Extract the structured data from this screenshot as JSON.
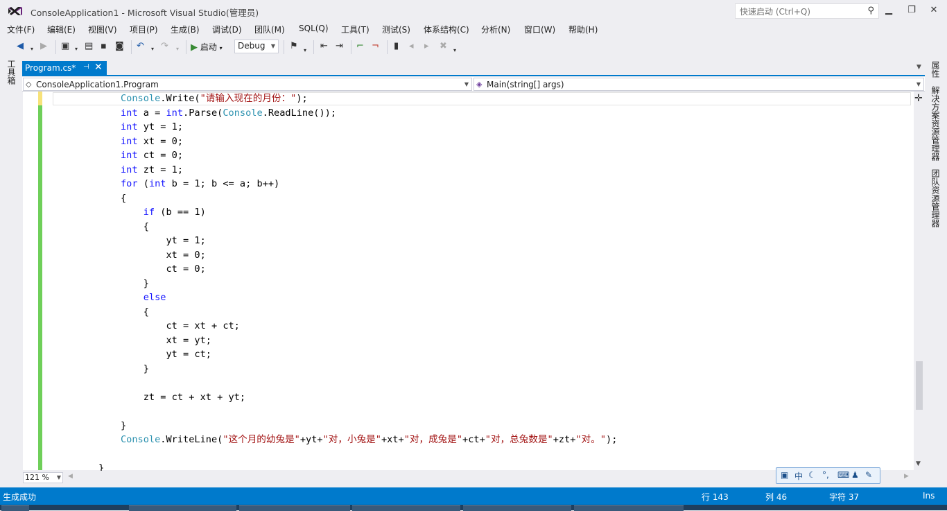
{
  "window": {
    "title": "ConsoleApplication1 - Microsoft Visual Studio(管理员)",
    "quick_launch_placeholder": "快速启动 (Ctrl+Q)"
  },
  "menu": [
    "文件(F)",
    "编辑(E)",
    "视图(V)",
    "项目(P)",
    "生成(B)",
    "调试(D)",
    "团队(M)",
    "SQL(Q)",
    "工具(T)",
    "测试(S)",
    "体系结构(C)",
    "分析(N)",
    "窗口(W)",
    "帮助(H)"
  ],
  "toolbar": {
    "start_label": "启动",
    "configuration": "Debug"
  },
  "left_panel": {
    "toolbox": "工具箱"
  },
  "right_panel": {
    "tabs": [
      "属性",
      "解决方案资源管理器",
      "团队资源管理器"
    ]
  },
  "tab": {
    "label": "Program.cs*",
    "pin": "⊣",
    "close": "✕"
  },
  "navigation": {
    "type": "ConsoleApplication1.Program",
    "member": "Main(string[] args)"
  },
  "editor": {
    "lines": [
      [
        [
          "ty",
          "Console"
        ],
        [
          "",
          "."
        ],
        [
          "",
          "Write("
        ],
        [
          "st",
          "\"请输入现在的月份：\""
        ],
        [
          "",
          ");"
        ]
      ],
      [
        [
          "kw",
          "int"
        ],
        [
          "",
          " a = "
        ],
        [
          "kw",
          "int"
        ],
        [
          "",
          ".Parse("
        ],
        [
          "ty",
          "Console"
        ],
        [
          "",
          ".ReadLine());"
        ]
      ],
      [
        [
          "kw",
          "int"
        ],
        [
          "",
          " yt = 1;"
        ]
      ],
      [
        [
          "kw",
          "int"
        ],
        [
          "",
          " xt = 0;"
        ]
      ],
      [
        [
          "kw",
          "int"
        ],
        [
          "",
          " ct = 0;"
        ]
      ],
      [
        [
          "kw",
          "int"
        ],
        [
          "",
          " zt = 1;"
        ]
      ],
      [
        [
          "kw",
          "for"
        ],
        [
          "",
          " ("
        ],
        [
          "kw",
          "int"
        ],
        [
          "",
          " b = 1; b <= a; b++)"
        ]
      ],
      [
        [
          "",
          "{"
        ]
      ],
      [
        [
          "",
          "    "
        ],
        [
          "kw",
          "if"
        ],
        [
          "",
          " (b == 1)"
        ]
      ],
      [
        [
          "",
          "    {"
        ]
      ],
      [
        [
          "",
          "        yt = 1;"
        ]
      ],
      [
        [
          "",
          "        xt = 0;"
        ]
      ],
      [
        [
          "",
          "        ct = 0;"
        ]
      ],
      [
        [
          "",
          "    }"
        ]
      ],
      [
        [
          "",
          "    "
        ],
        [
          "kw",
          "else"
        ]
      ],
      [
        [
          "",
          "    {"
        ]
      ],
      [
        [
          "",
          "        ct = xt + ct;"
        ]
      ],
      [
        [
          "",
          "        xt = yt;"
        ]
      ],
      [
        [
          "",
          "        yt = ct;"
        ]
      ],
      [
        [
          "",
          "    }"
        ]
      ],
      [
        [
          "",
          ""
        ]
      ],
      [
        [
          "",
          "    zt = ct + xt + yt;"
        ]
      ],
      [
        [
          "",
          ""
        ]
      ],
      [
        [
          "",
          "}"
        ]
      ],
      [
        [
          "ty",
          "Console"
        ],
        [
          "",
          ".WriteLine("
        ],
        [
          "st",
          "\"这个月的幼兔是\""
        ],
        [
          "",
          "+yt+"
        ],
        [
          "st",
          "\"对，小兔是\""
        ],
        [
          "",
          "+xt+"
        ],
        [
          "st",
          "\"对，成兔是\""
        ],
        [
          "",
          "+ct+"
        ],
        [
          "st",
          "\"对，总兔数是\""
        ],
        [
          "",
          "+zt+"
        ],
        [
          "st",
          "\"对。\""
        ],
        [
          "",
          ");"
        ]
      ],
      [
        [
          "",
          ""
        ]
      ],
      [
        [
          "",
          "}"
        ]
      ]
    ]
  },
  "zoom": "121 %",
  "ime": {
    "mode": "中"
  },
  "status": {
    "message": "生成成功",
    "line": "行 143",
    "column": "列 46",
    "char": "字符 37",
    "insert_mode": "Ins"
  }
}
